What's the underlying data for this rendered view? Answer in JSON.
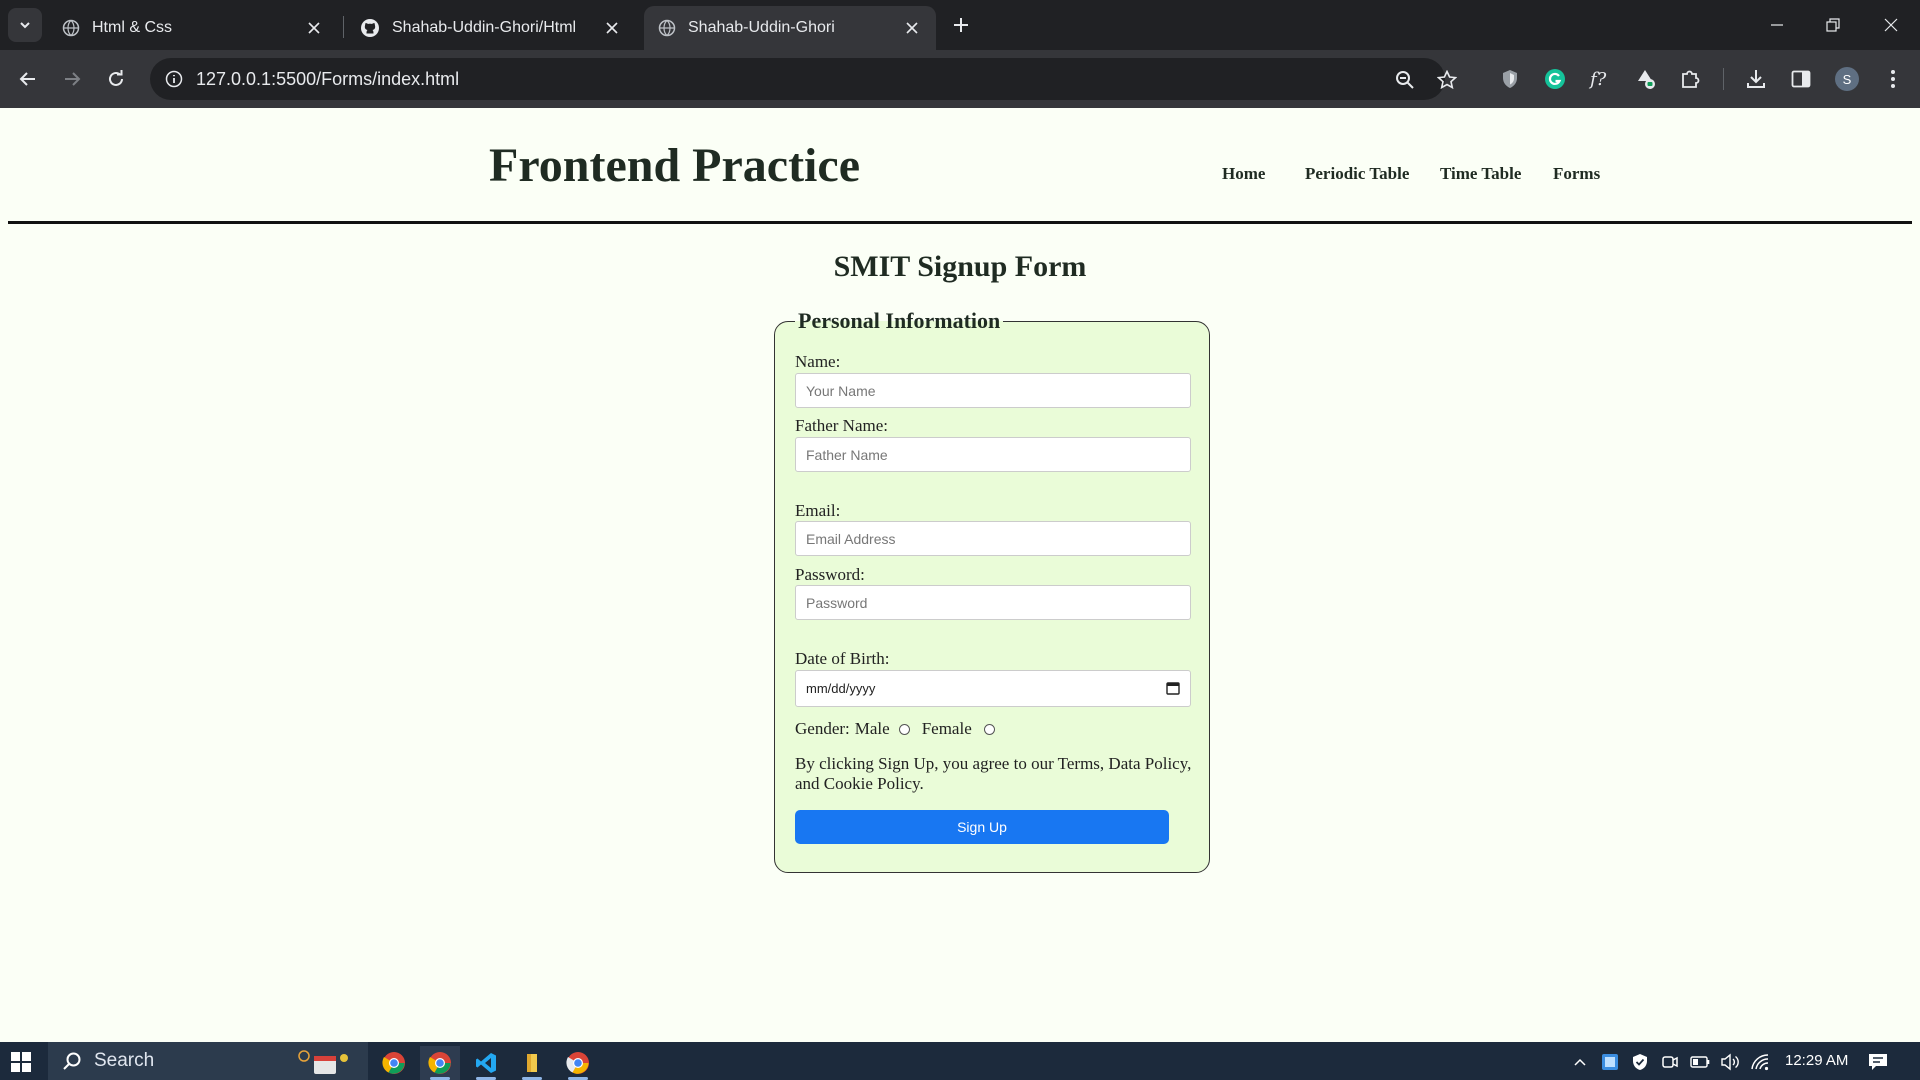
{
  "browser": {
    "tabs": [
      {
        "title": "Html & Css",
        "icon": "globe-icon",
        "active": false
      },
      {
        "title": "Shahab-Uddin-Ghori/Html",
        "icon": "github-icon",
        "active": false
      },
      {
        "title": "Shahab-Uddin-Ghori",
        "icon": "globe-icon",
        "active": true
      }
    ],
    "url": "127.0.0.1:5500/Forms/index.html",
    "profile_initial": "S"
  },
  "site": {
    "title": "Frontend Practice",
    "nav": [
      "Home",
      "Periodic Table",
      "Time Table",
      "Forms"
    ]
  },
  "form": {
    "heading": "SMIT Signup Form",
    "legend": "Personal Information",
    "fields": [
      {
        "label": "Name:",
        "placeholder": "Your Name"
      },
      {
        "label": "Father Name:",
        "placeholder": "Father Name"
      },
      {
        "label": "Email:",
        "placeholder": "Email Address"
      },
      {
        "label": "Password:",
        "placeholder": "Password"
      }
    ],
    "dob": {
      "label": "Date of Birth:",
      "value": "mm/dd/yyyy"
    },
    "gender": {
      "label": "Gender:",
      "options": [
        "Male",
        "Female"
      ]
    },
    "terms": "By clicking Sign Up, you agree to our Terms, Data Policy, and Cookie Policy.",
    "submit": "Sign Up"
  },
  "taskbar": {
    "search_label": "Search",
    "time": "12:29 AM"
  },
  "colors": {
    "page_bg": "#fbfff6",
    "fieldset_bg": "#eafcd8",
    "button": "#1877f2",
    "chrome_dark": "#202124",
    "chrome_toolbar": "#35363a",
    "taskbar": "#1c2a3c"
  }
}
